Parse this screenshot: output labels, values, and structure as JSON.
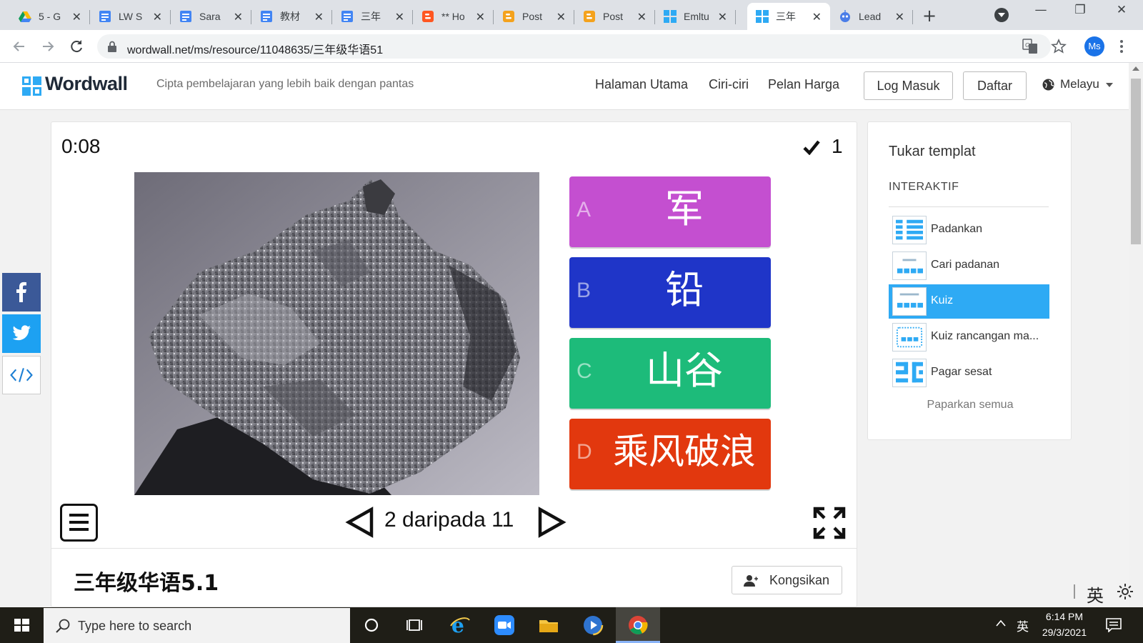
{
  "browser": {
    "tabs": [
      {
        "title": "5 - G",
        "icon": "google-drive-icon"
      },
      {
        "title": "LW S",
        "icon": "google-docs-icon"
      },
      {
        "title": "Sara",
        "icon": "google-docs-icon"
      },
      {
        "title": "教材",
        "icon": "google-docs-icon"
      },
      {
        "title": "三年",
        "icon": "google-docs-icon"
      },
      {
        "title": "** Ho",
        "icon": "blogger-icon"
      },
      {
        "title": "Post",
        "icon": "blogger-icon"
      },
      {
        "title": "Post",
        "icon": "blogger-icon"
      },
      {
        "title": "Emltu",
        "icon": "wordwall-icon"
      },
      {
        "title": "三年",
        "icon": "wordwall-icon"
      },
      {
        "title": "Lead",
        "icon": "bot-icon"
      }
    ],
    "url": "wordwall.net/ms/resource/11048635/三年级华语51",
    "profile_initials": "Ms"
  },
  "site": {
    "logo": "Wordwall",
    "tagline": "Cipta pembelajaran yang lebih baik dengan pantas",
    "nav": [
      "Halaman Utama",
      "Ciri-ciri",
      "Pelan Harga"
    ],
    "login": "Log Masuk",
    "signup": "Daftar",
    "language": "Melayu"
  },
  "activity": {
    "timer": "0:08",
    "score": "1",
    "image": "dark-gray-mineral-rock-photo",
    "answers": [
      {
        "letter": "A",
        "text": "军",
        "color": "#c44fd0"
      },
      {
        "letter": "B",
        "text": "铅",
        "color": "#1f35c8"
      },
      {
        "letter": "C",
        "text": "山谷",
        "color": "#1dbb7a"
      },
      {
        "letter": "D",
        "text": "乘风破浪",
        "color": "#e2380e"
      }
    ],
    "counter": "2 daripada 11"
  },
  "resource": {
    "title": "三年级华语5.1",
    "share_label": "Kongsikan"
  },
  "templates": {
    "heading": "Tukar templat",
    "section": "INTERAKTIF",
    "items": [
      {
        "label": "Padankan",
        "active": false
      },
      {
        "label": "Cari padanan",
        "active": false
      },
      {
        "label": "Kuiz",
        "active": true
      },
      {
        "label": "Kuiz rancangan ma...",
        "active": false
      },
      {
        "label": "Pagar sesat",
        "active": false
      }
    ],
    "show_all": "Paparkan semua"
  },
  "ime_indicator": "英",
  "taskbar": {
    "search_placeholder": "Type here to search",
    "ime": "英",
    "time": "6:14 PM",
    "date": "29/3/2021"
  },
  "colors": {
    "accent": "#2eaaf4",
    "facebook": "#3b5998",
    "twitter": "#1da1f2",
    "chrome_active_underline": "#8ab4f8"
  }
}
